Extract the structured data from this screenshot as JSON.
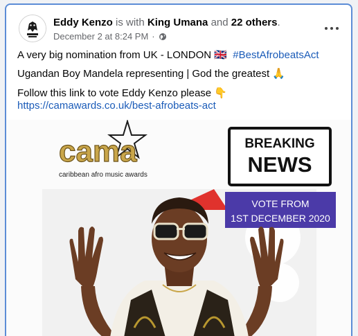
{
  "post": {
    "author": "Eddy Kenzo",
    "with_text": "is with",
    "tagged": "King Umana",
    "and_text": "and",
    "others": "22 others",
    "timestamp": "December 2 at 8:24 PM",
    "separator": "·",
    "text": {
      "line1_main": "A very big nomination from UK - LONDON 🇬🇧",
      "hashtag": "#BestAfrobeatsAct",
      "line2": "Ugandan Boy Mandela representing | God the greatest 🙏",
      "line3": "Follow this link to vote Eddy Kenzo please 👇",
      "link": "https://camawards.co.uk/best-afrobeats-act"
    }
  },
  "media": {
    "logo_word": "cama",
    "logo_sub": "caribbean afro music awards",
    "breaking_1": "BREAKING",
    "breaking_2": "NEWS",
    "vote_1": "VOTE FROM",
    "vote_2": "1ST DECEMBER 2020"
  },
  "colors": {
    "link": "#1a5bb8",
    "border": "#5b8cd6",
    "vote_bg": "#4b3aa8",
    "gold": "#b8972f"
  },
  "icons": {
    "privacy": "globe-icon",
    "more": "more-horizontal-icon"
  }
}
